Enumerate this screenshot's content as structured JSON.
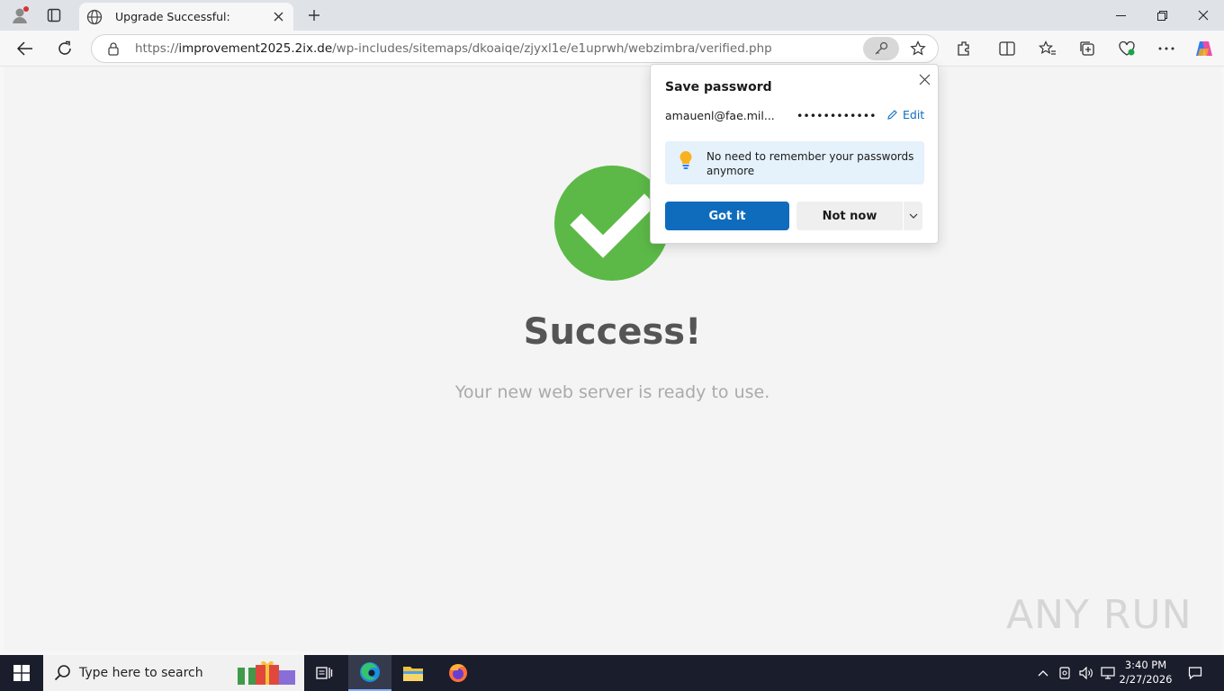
{
  "browser": {
    "tab_title": "Upgrade Successful:",
    "url_prefix": "https://",
    "url_host": "improvement2025.2ix.de",
    "url_path": "/wp-includes/sitemaps/dkoaiqe/zjyxl1e/e1uprwh/webzimbra/verified.php"
  },
  "page": {
    "heading": "Success!",
    "subtext": "Your new web server is ready to use.",
    "watermark": "ANY RUN"
  },
  "password_popup": {
    "title": "Save password",
    "username": "amauenl@fae.mil...",
    "password_mask": "••••••••••••",
    "edit_label": "Edit",
    "tip_text": "No need to remember your passwords anymore",
    "got_it_label": "Got it",
    "not_now_label": "Not now"
  },
  "taskbar": {
    "search_placeholder": "Type here to search",
    "time": "3:40 PM",
    "date": "2/27/2026"
  },
  "colors": {
    "accent": "#0f6cbd",
    "success_green": "#5cb947",
    "taskbar": "#1a1d2b"
  }
}
